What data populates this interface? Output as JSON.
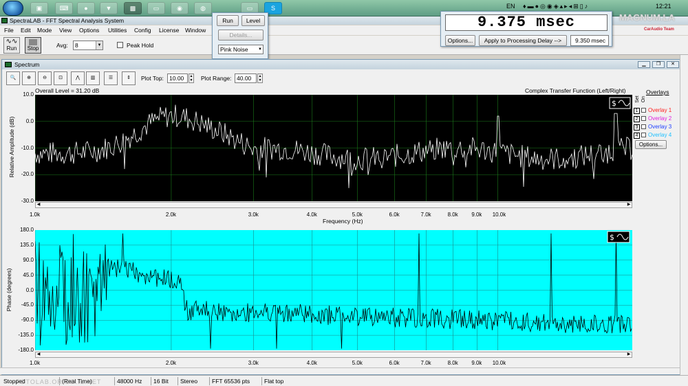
{
  "taskbar": {
    "lang": "EN",
    "clock": "12:21"
  },
  "app": {
    "title": "SpectraLAB - FFT Spectral Analysis System"
  },
  "menu": {
    "items": [
      "File",
      "Edit",
      "Mode",
      "View",
      "Options",
      "Utilities",
      "Config",
      "License",
      "Window"
    ]
  },
  "toolbar": {
    "run_label": "Run",
    "stop_label": "Stop",
    "avg_label": "Avg:",
    "avg_value": "8",
    "peak_hold_label": "Peak Hold"
  },
  "popup": {
    "run_label": "Run",
    "level_label": "Level",
    "details_label": "Details...",
    "noise_value": "Pink Noise"
  },
  "delay": {
    "display": "9.375 msec",
    "options_label": "Options...",
    "apply_label": "Apply to Processing Delay -->",
    "value": "9.350 msec"
  },
  "watermark": {
    "brand": "MAGNUM.LA",
    "sub": "CarAudio Team"
  },
  "spectrum": {
    "window_title": "Spectrum",
    "plot_top_label": "Plot Top:",
    "plot_top_value": "10.00",
    "plot_range_label": "Plot Range:",
    "plot_range_value": "40.00",
    "overall_level": "Overall Level = 31.20 dB",
    "function_label": "Complex Transfer Function (Left/Right)",
    "amp_ylabel": "Relative Amplitude (dB)",
    "phase_ylabel": "Phase (degrees)",
    "xlabel": "Frequency (Hz)",
    "amp_ticks": [
      "10.0",
      "0.0",
      "-10.0",
      "-20.0",
      "-30.0"
    ],
    "phase_ticks": [
      "180.0",
      "135.0",
      "90.0",
      "45.0",
      "0.0",
      "-45.0",
      "-90.0",
      "-135.0",
      "-180.0"
    ],
    "freq_ticks": [
      "1.0k",
      "2.0k",
      "3.0k",
      "4.0k",
      "5.0k",
      "6.0k",
      "7.0k",
      "8.0k",
      "9.0k",
      "10.0k"
    ],
    "overlays": {
      "title": "Overlays",
      "set_label": "Set",
      "on_label": "On",
      "items": [
        {
          "num": "1",
          "label": "Overlay 1",
          "color": "#ff2020"
        },
        {
          "num": "2",
          "label": "Overlay 2",
          "color": "#e020e0"
        },
        {
          "num": "3",
          "label": "Overlay 3",
          "color": "#2040ff"
        },
        {
          "num": "4",
          "label": "Overlay 4",
          "color": "#20c0ff"
        }
      ],
      "options_label": "Options..."
    }
  },
  "status": {
    "state": "Stopped",
    "mode": "(Real Time)",
    "rate": "48000 Hz",
    "bits": "16 Bit",
    "channels": "Stereo",
    "fft": "FFT 65536 pts",
    "window": "Flat top",
    "overlay_text": "FOTOLAB.OR.CO.IL.NET"
  }
}
